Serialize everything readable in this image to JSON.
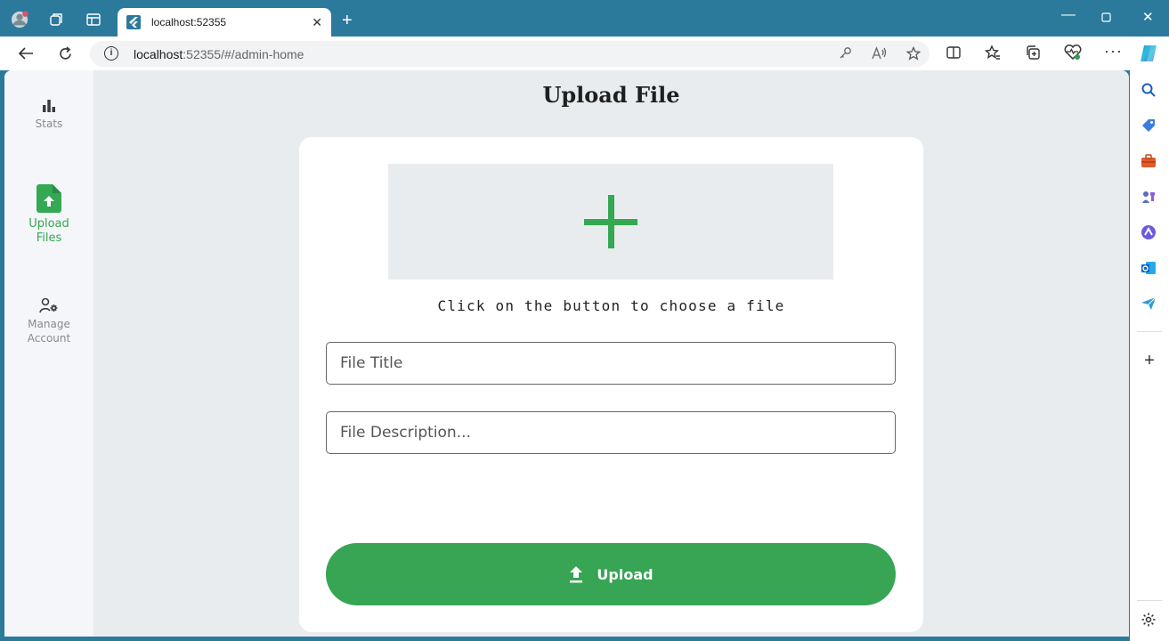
{
  "browser": {
    "tab_title": "localhost:52355",
    "url_host": "localhost",
    "url_rest": ":52355/#/admin-home",
    "new_tab_glyph": "+",
    "close_glyph": "✕"
  },
  "nav_rail": {
    "items": [
      {
        "label": "Stats",
        "icon": "bar-chart-icon",
        "active": false
      },
      {
        "label": "Upload\nFiles",
        "icon": "file-upload-icon",
        "active": true
      },
      {
        "label": "Manage\nAccount",
        "icon": "manage-account-icon",
        "active": false
      }
    ]
  },
  "page": {
    "title": "Upload File",
    "picker_caption": "Click on the button to choose a file",
    "title_placeholder": "File Title",
    "description_placeholder": "File Description...",
    "upload_label": "Upload"
  },
  "colors": {
    "accent": "#34a853",
    "browser_frame": "#2b7a9c",
    "content_bg": "#e9ecee"
  }
}
